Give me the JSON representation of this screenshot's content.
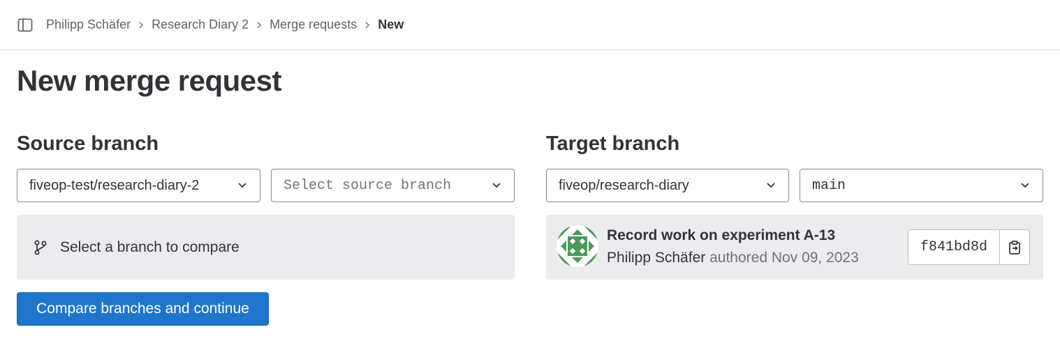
{
  "breadcrumb": {
    "items": [
      "Philipp Schäfer",
      "Research Diary 2",
      "Merge requests"
    ],
    "current": "New"
  },
  "page": {
    "title": "New merge request"
  },
  "source": {
    "title": "Source branch",
    "project": "fiveop-test/research-diary-2",
    "branch_placeholder": "Select source branch",
    "empty_message": "Select a branch to compare"
  },
  "target": {
    "title": "Target branch",
    "project": "fiveop/research-diary",
    "branch": "main",
    "commit": {
      "title": "Record work on experiment A-13",
      "author": "Philipp Schäfer",
      "authored_text": "authored Nov 09, 2023",
      "sha": "f841bd8d"
    }
  },
  "actions": {
    "compare_label": "Compare branches and continue"
  },
  "colors": {
    "primary": "#1f75cb",
    "panel_bg": "#ececef",
    "avatar_green": "#4a9a5a"
  },
  "icons": [
    "sidebar-toggle-icon",
    "chevron-right-icon",
    "chevron-down-icon",
    "branch-icon",
    "copy-clipboard-icon"
  ]
}
